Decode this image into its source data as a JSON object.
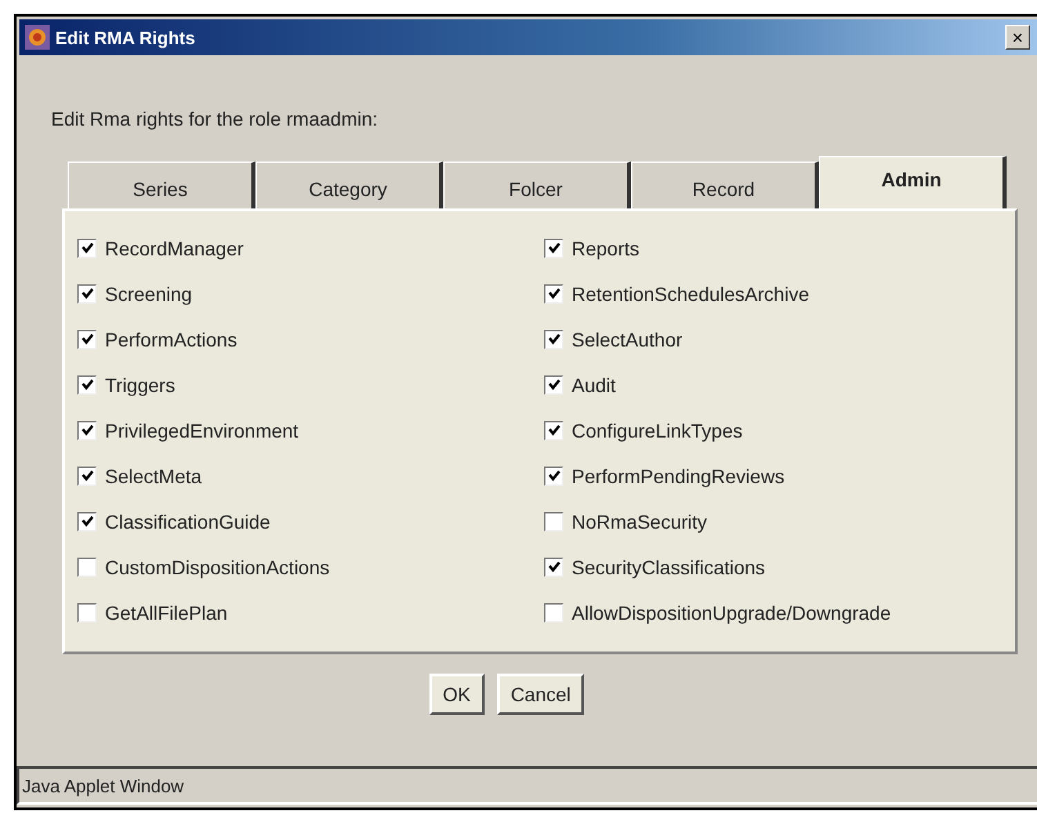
{
  "window": {
    "title": "Edit RMA Rights",
    "close": "×"
  },
  "prompt": "Edit Rma rights for the role rmaadmin:",
  "tabs": [
    {
      "label": "Series",
      "selected": false
    },
    {
      "label": "Category",
      "selected": false
    },
    {
      "label": "Folcer",
      "selected": false
    },
    {
      "label": "Record",
      "selected": false
    },
    {
      "label": "Admin",
      "selected": true
    }
  ],
  "columns": [
    {
      "rights": [
        {
          "label": "RecordManager",
          "checked": true
        },
        {
          "label": "Screening",
          "checked": true
        },
        {
          "label": "PerformActions",
          "checked": true
        },
        {
          "label": "Triggers",
          "checked": true
        },
        {
          "label": "PrivilegedEnvironment",
          "checked": true
        },
        {
          "label": "SelectMeta",
          "checked": true
        },
        {
          "label": "ClassificationGuide",
          "checked": true
        },
        {
          "label": "CustomDispositionActions",
          "checked": false
        },
        {
          "label": "GetAllFilePlan",
          "checked": false
        }
      ]
    },
    {
      "rights": [
        {
          "label": "Reports",
          "checked": true
        },
        {
          "label": "RetentionSchedulesArchive",
          "checked": true
        },
        {
          "label": "SelectAuthor",
          "checked": true
        },
        {
          "label": "Audit",
          "checked": true
        },
        {
          "label": "ConfigureLinkTypes",
          "checked": true
        },
        {
          "label": "PerformPendingReviews",
          "checked": true
        },
        {
          "label": "NoRmaSecurity",
          "checked": false
        },
        {
          "label": "SecurityClassifications",
          "checked": true
        },
        {
          "label": "AllowDispositionUpgrade/Downgrade",
          "checked": false
        }
      ]
    }
  ],
  "buttons": [
    "OK",
    "Cancel"
  ],
  "status_bar": "Java Applet Window"
}
